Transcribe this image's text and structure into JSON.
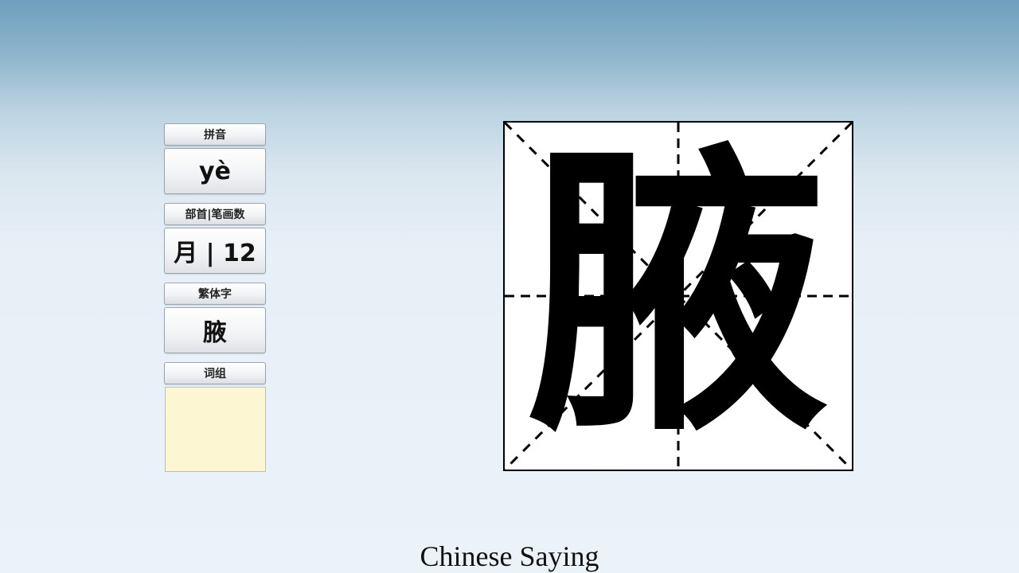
{
  "panel": {
    "pinyin_label": "拼音",
    "pinyin_value": "yè",
    "radical_strokes_label": "部首|笔画数",
    "radical_strokes_value": "月 | 12",
    "traditional_label": "繁体字",
    "traditional_value": "腋",
    "words_label": "词组",
    "words_value": ""
  },
  "grid": {
    "character": "腋"
  },
  "caption": "Chinese Saying",
  "colors": {
    "words_box_bg": "#fdf6d3",
    "grid_line": "#000000"
  }
}
